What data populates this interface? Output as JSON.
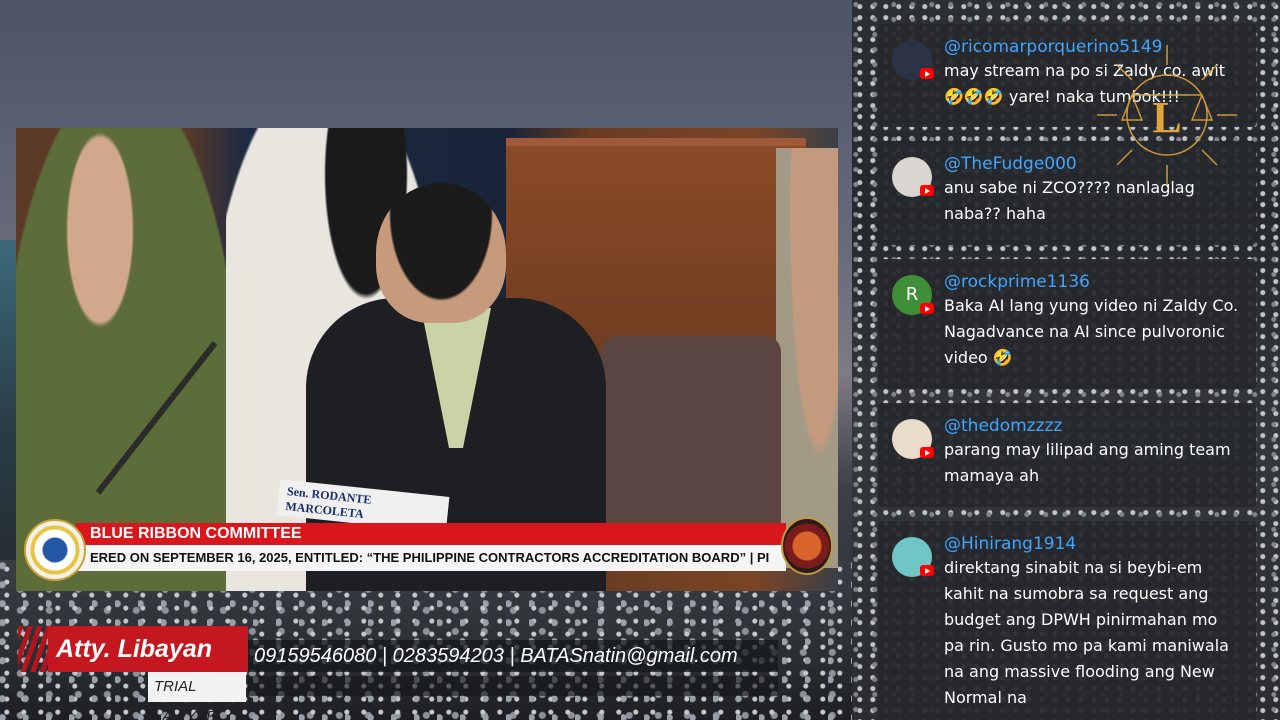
{
  "video": {
    "committee": "BLUE RIBBON COMMITTEE",
    "ticker": "ERED ON SEPTEMBER 16, 2025, ENTITLED: “THE PHILIPPINE CONTRACTORS ACCREDITATION BOARD”  |  PI",
    "nameplate": "Sen. RODANTE MARCOLETA"
  },
  "brand": {
    "name": "Atty. Libayan",
    "title": "TRIAL LAWYER",
    "contact": "09159546080 | 0283594203 | BATASnatin@gmail.com"
  },
  "chat": {
    "messages": [
      {
        "user": "@ricomarporquerino5149",
        "text": "may stream na po si Zaldy co. awit 🤣🤣🤣 yare! naka tumbok!!!",
        "avatar_color": "#2b3447",
        "avatar_letter": ""
      },
      {
        "user": "@TheFudge000",
        "text": "anu sabe ni ZCO???? nanlaglag naba?? haha",
        "avatar_color": "#d9d6d2",
        "avatar_letter": ""
      },
      {
        "user": "@rockprime1136",
        "text": "Baka AI lang yung video ni Zaldy Co. Nagadvance na AI since pulvoronic video 🤣",
        "avatar_color": "#3f8f3a",
        "avatar_letter": "R"
      },
      {
        "user": "@thedomzzzz",
        "text": "parang may lilipad ang aming team mamaya ah",
        "avatar_color": "#e9dccb",
        "avatar_letter": ""
      },
      {
        "user": "@Hinirang1914",
        "text": "direktang sinabit na si beybi-em kahit na sumobra sa request ang budget ang DPWH pinirmahan mo pa rin. Gusto mo pa kami maniwala na ang massive flooding ang New Normal na",
        "avatar_color": "#6fc6c4",
        "avatar_letter": ""
      }
    ]
  },
  "logo": {
    "letter": "L",
    "color": "#e0a43a"
  }
}
